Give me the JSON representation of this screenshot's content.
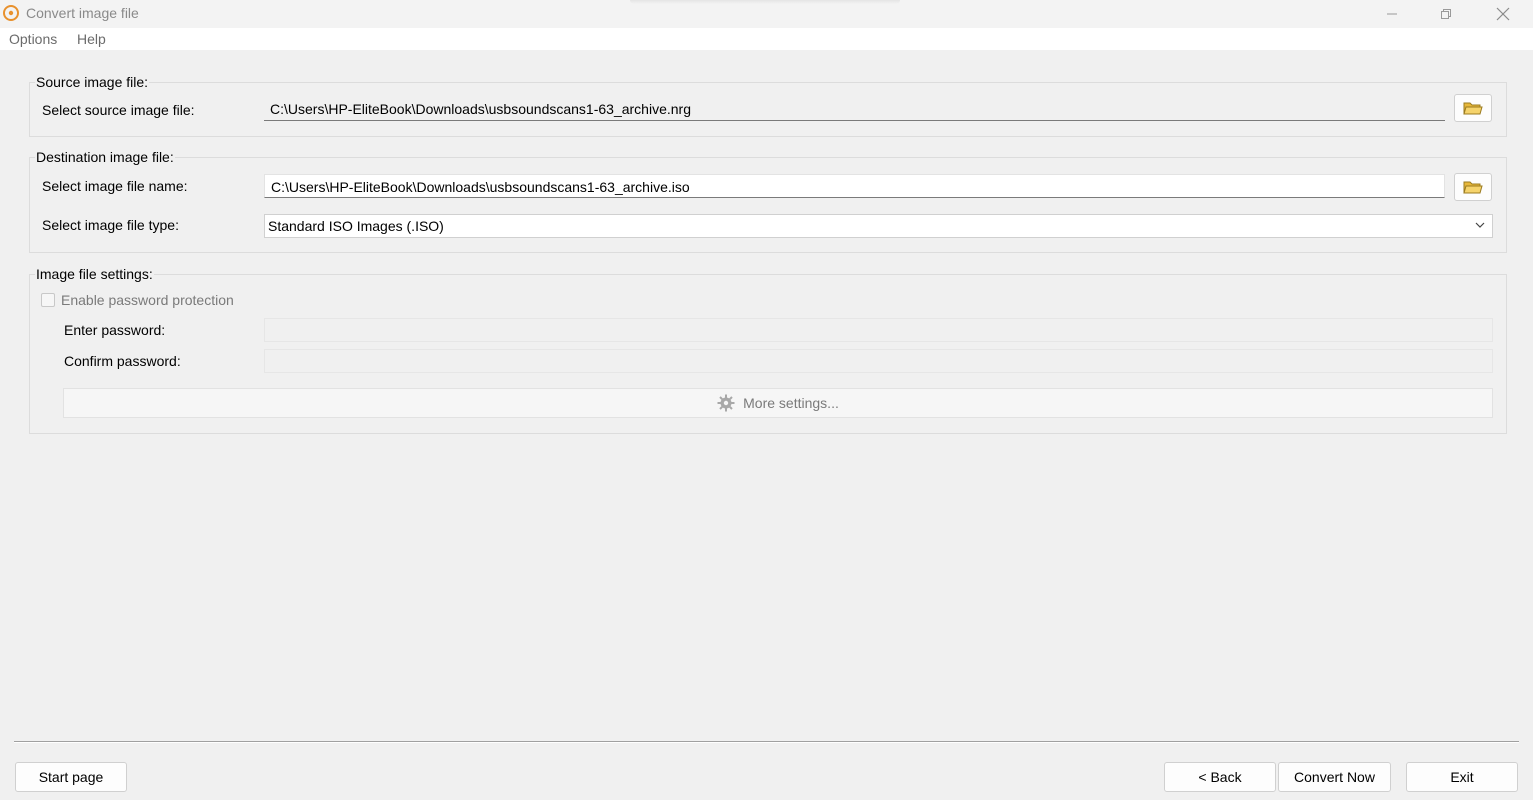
{
  "window": {
    "title": "Convert image file"
  },
  "menu": {
    "options": "Options",
    "help": "Help"
  },
  "source": {
    "group_title": "Source image file:",
    "label": "Select source image file:",
    "path": "C:\\Users\\HP-EliteBook\\Downloads\\usbsoundscans1-63_archive.nrg"
  },
  "destination": {
    "group_title": "Destination image file:",
    "name_label": "Select image file name:",
    "path": "C:\\Users\\HP-EliteBook\\Downloads\\usbsoundscans1-63_archive.iso",
    "type_label": "Select image file type:",
    "type_selected": "Standard ISO Images (.ISO)"
  },
  "settings": {
    "group_title": "Image file settings:",
    "password_checkbox_label": "Enable password protection",
    "password_checked": false,
    "enter_password_label": "Enter password:",
    "confirm_password_label": "Confirm password:",
    "more_settings_label": "More settings..."
  },
  "footer": {
    "start_page": "Start page",
    "back": "< Back",
    "convert_now": "Convert Now",
    "exit": "Exit"
  },
  "colors": {
    "accent": "#e8912d",
    "folder": "#e8b83a",
    "background": "#f0f0f0"
  }
}
